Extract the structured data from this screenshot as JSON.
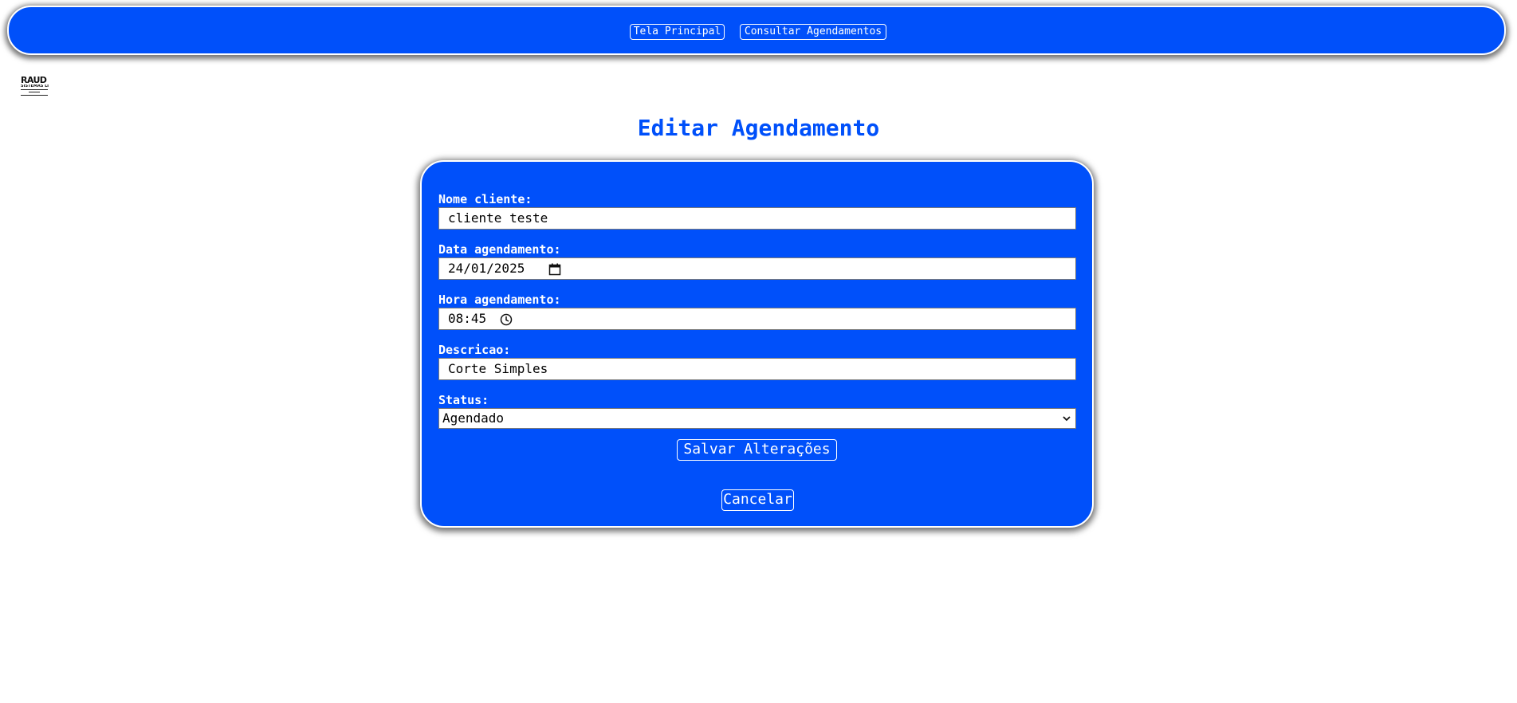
{
  "nav": {
    "home_label": "Tela Principal",
    "consult_label": "Consultar Agendamentos"
  },
  "logo": {
    "word": "RAUD",
    "sub": "SISTEMAS LT"
  },
  "page": {
    "title": "Editar Agendamento"
  },
  "form": {
    "client_label": "Nome cliente:",
    "client_value": "cliente teste",
    "date_label": "Data agendamento:",
    "date_value": "24/01/2025",
    "time_label": "Hora agendamento:",
    "time_value": "08:45",
    "description_label": "Descricao:",
    "description_value": "Corte Simples",
    "status_label": "Status:",
    "status_value": "Agendado",
    "save_label": "Salvar Alterações",
    "cancel_label": "Cancelar"
  },
  "icons": {
    "date": "calendar-icon",
    "time": "clock-icon",
    "select": "chevron-down-icon"
  },
  "colors": {
    "primary": "#0050fa",
    "on_primary": "#ffffff",
    "background": "#ffffff"
  }
}
